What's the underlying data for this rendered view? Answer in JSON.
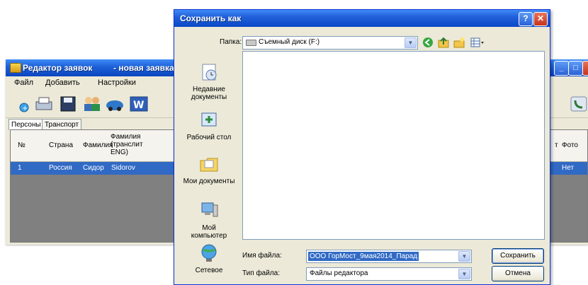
{
  "app": {
    "title": "Редактор заявок",
    "subtitle": "- новая заявка",
    "menu": [
      "Файл",
      "Добавить",
      "Настройки"
    ],
    "tabs": [
      "Персоны",
      "Транспорт"
    ],
    "grid": {
      "headers": {
        "num": "№",
        "country": "Страна",
        "surname": "Фамилия",
        "translit": "Фамилия (транслит ENG)",
        "t": "т",
        "photo": "Фото"
      },
      "row": {
        "num": "1",
        "country": "Россия",
        "surname": "Сидор",
        "translit": "Sidorov",
        "photo": "Нет"
      }
    }
  },
  "dialog": {
    "title": "Сохранить как",
    "folder_label": "Папка:",
    "folder_value": "Съемный диск (F:)",
    "places": [
      "Недавние документы",
      "Рабочий стол",
      "Мои документы",
      "Мой компьютер",
      "Сетевое"
    ],
    "filename_label": "Имя файла:",
    "filename_value": "ООО ГорМост_9мая2014_Парад",
    "filetype_label": "Тип файла:",
    "filetype_value": "Файлы редактора",
    "save_button": "Сохранить",
    "cancel_button": "Отмена",
    "help_button": "?",
    "close_button": "✕"
  },
  "icons": [
    "back-icon",
    "up-folder-icon",
    "new-folder-icon",
    "view-menu-icon"
  ]
}
